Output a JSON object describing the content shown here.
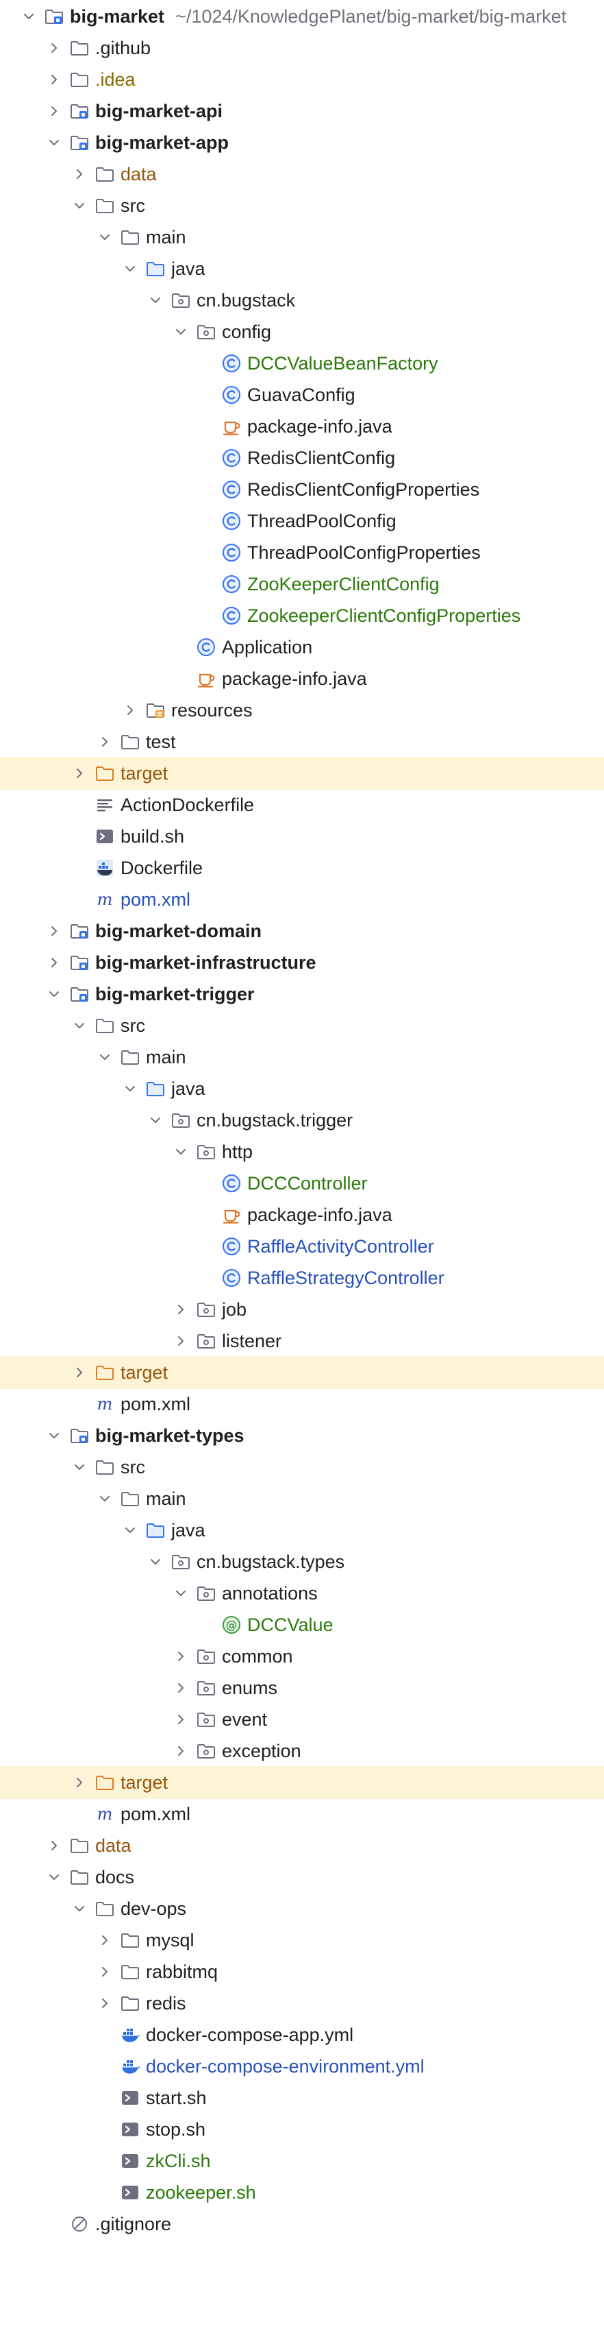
{
  "colors": {
    "module_green": "#2b7a0b",
    "modified_blue": "#2750b8",
    "excluded_orange": "#94560f",
    "highlight_row": "#fdf4d6",
    "folder_gray": "#6c707e",
    "source_blue": "#3574f0",
    "class_blue": "#3574f0",
    "docker_blue": "#2f6fe0"
  },
  "project": {
    "name": "big-market",
    "path": "~/1024/KnowledgePlanet/big-market/big-market"
  },
  "rows": [
    {
      "label": "big-market",
      "depth": 0,
      "chevron": "down",
      "icon": "module-folder-icon",
      "style": "bold",
      "path_key": "project.path"
    },
    {
      "label": ".github",
      "depth": 1,
      "chevron": "right",
      "icon": "folder-icon",
      "style": "normal"
    },
    {
      "label": ".idea",
      "depth": 1,
      "chevron": "right",
      "icon": "folder-icon",
      "style": "ignored"
    },
    {
      "label": "big-market-api",
      "depth": 1,
      "chevron": "right",
      "icon": "module-folder-icon",
      "style": "bold"
    },
    {
      "label": "big-market-app",
      "depth": 1,
      "chevron": "down",
      "icon": "module-folder-icon",
      "style": "bold"
    },
    {
      "label": "data",
      "depth": 2,
      "chevron": "right",
      "icon": "folder-icon",
      "style": "excluded"
    },
    {
      "label": "src",
      "depth": 2,
      "chevron": "down",
      "icon": "folder-icon",
      "style": "normal"
    },
    {
      "label": "main",
      "depth": 3,
      "chevron": "down",
      "icon": "folder-icon",
      "style": "normal"
    },
    {
      "label": "java",
      "depth": 4,
      "chevron": "down",
      "icon": "source-folder-icon",
      "style": "normal"
    },
    {
      "label": "cn.bugstack",
      "depth": 5,
      "chevron": "down",
      "icon": "package-icon",
      "style": "normal"
    },
    {
      "label": "config",
      "depth": 6,
      "chevron": "down",
      "icon": "package-icon",
      "style": "normal"
    },
    {
      "label": "DCCValueBeanFactory",
      "depth": 7,
      "chevron": "none",
      "icon": "class-icon",
      "style": "green"
    },
    {
      "label": "GuavaConfig",
      "depth": 7,
      "chevron": "none",
      "icon": "class-icon",
      "style": "normal"
    },
    {
      "label": "package-info.java",
      "depth": 7,
      "chevron": "none",
      "icon": "java-file-icon",
      "style": "normal"
    },
    {
      "label": "RedisClientConfig",
      "depth": 7,
      "chevron": "none",
      "icon": "class-icon",
      "style": "normal"
    },
    {
      "label": "RedisClientConfigProperties",
      "depth": 7,
      "chevron": "none",
      "icon": "class-icon",
      "style": "normal"
    },
    {
      "label": "ThreadPoolConfig",
      "depth": 7,
      "chevron": "none",
      "icon": "class-icon",
      "style": "normal"
    },
    {
      "label": "ThreadPoolConfigProperties",
      "depth": 7,
      "chevron": "none",
      "icon": "class-icon",
      "style": "normal"
    },
    {
      "label": "ZooKeeperClientConfig",
      "depth": 7,
      "chevron": "none",
      "icon": "class-icon",
      "style": "green"
    },
    {
      "label": "ZookeeperClientConfigProperties",
      "depth": 7,
      "chevron": "none",
      "icon": "class-icon",
      "style": "green"
    },
    {
      "label": "Application",
      "depth": 6,
      "chevron": "none",
      "icon": "class-icon",
      "style": "normal"
    },
    {
      "label": "package-info.java",
      "depth": 6,
      "chevron": "none",
      "icon": "java-file-icon",
      "style": "normal"
    },
    {
      "label": "resources",
      "depth": 4,
      "chevron": "right",
      "icon": "resources-folder-icon",
      "style": "normal"
    },
    {
      "label": "test",
      "depth": 3,
      "chevron": "right",
      "icon": "folder-icon",
      "style": "normal"
    },
    {
      "label": "target",
      "depth": 2,
      "chevron": "right",
      "icon": "excluded-folder-icon",
      "style": "excluded",
      "highlight": true
    },
    {
      "label": "ActionDockerfile",
      "depth": 2,
      "chevron": "none",
      "icon": "text-file-icon",
      "style": "normal"
    },
    {
      "label": "build.sh",
      "depth": 2,
      "chevron": "none",
      "icon": "shell-script-icon",
      "style": "normal"
    },
    {
      "label": "Dockerfile",
      "depth": 2,
      "chevron": "none",
      "icon": "dockerfile-icon",
      "style": "normal"
    },
    {
      "label": "pom.xml",
      "depth": 2,
      "chevron": "none",
      "icon": "maven-icon",
      "style": "blue"
    },
    {
      "label": "big-market-domain",
      "depth": 1,
      "chevron": "right",
      "icon": "module-folder-icon",
      "style": "bold"
    },
    {
      "label": "big-market-infrastructure",
      "depth": 1,
      "chevron": "right",
      "icon": "module-folder-icon",
      "style": "bold"
    },
    {
      "label": "big-market-trigger",
      "depth": 1,
      "chevron": "down",
      "icon": "module-folder-icon",
      "style": "bold"
    },
    {
      "label": "src",
      "depth": 2,
      "chevron": "down",
      "icon": "folder-icon",
      "style": "normal"
    },
    {
      "label": "main",
      "depth": 3,
      "chevron": "down",
      "icon": "folder-icon",
      "style": "normal"
    },
    {
      "label": "java",
      "depth": 4,
      "chevron": "down",
      "icon": "source-folder-icon",
      "style": "normal"
    },
    {
      "label": "cn.bugstack.trigger",
      "depth": 5,
      "chevron": "down",
      "icon": "package-icon",
      "style": "normal"
    },
    {
      "label": "http",
      "depth": 6,
      "chevron": "down",
      "icon": "package-icon",
      "style": "normal"
    },
    {
      "label": "DCCController",
      "depth": 7,
      "chevron": "none",
      "icon": "class-icon",
      "style": "green"
    },
    {
      "label": "package-info.java",
      "depth": 7,
      "chevron": "none",
      "icon": "java-file-icon",
      "style": "normal"
    },
    {
      "label": "RaffleActivityController",
      "depth": 7,
      "chevron": "none",
      "icon": "class-icon",
      "style": "blue"
    },
    {
      "label": "RaffleStrategyController",
      "depth": 7,
      "chevron": "none",
      "icon": "class-icon",
      "style": "blue"
    },
    {
      "label": "job",
      "depth": 6,
      "chevron": "right",
      "icon": "package-icon",
      "style": "normal"
    },
    {
      "label": "listener",
      "depth": 6,
      "chevron": "right",
      "icon": "package-icon",
      "style": "normal"
    },
    {
      "label": "target",
      "depth": 2,
      "chevron": "right",
      "icon": "excluded-folder-icon",
      "style": "excluded",
      "highlight": true
    },
    {
      "label": "pom.xml",
      "depth": 2,
      "chevron": "none",
      "icon": "maven-icon",
      "style": "normal"
    },
    {
      "label": "big-market-types",
      "depth": 1,
      "chevron": "down",
      "icon": "module-folder-icon",
      "style": "bold"
    },
    {
      "label": "src",
      "depth": 2,
      "chevron": "down",
      "icon": "folder-icon",
      "style": "normal"
    },
    {
      "label": "main",
      "depth": 3,
      "chevron": "down",
      "icon": "folder-icon",
      "style": "normal"
    },
    {
      "label": "java",
      "depth": 4,
      "chevron": "down",
      "icon": "source-folder-icon",
      "style": "normal"
    },
    {
      "label": "cn.bugstack.types",
      "depth": 5,
      "chevron": "down",
      "icon": "package-icon",
      "style": "normal"
    },
    {
      "label": "annotations",
      "depth": 6,
      "chevron": "down",
      "icon": "package-icon",
      "style": "normal"
    },
    {
      "label": "DCCValue",
      "depth": 7,
      "chevron": "none",
      "icon": "annotation-icon",
      "style": "green"
    },
    {
      "label": "common",
      "depth": 6,
      "chevron": "right",
      "icon": "package-icon",
      "style": "normal"
    },
    {
      "label": "enums",
      "depth": 6,
      "chevron": "right",
      "icon": "package-icon",
      "style": "normal"
    },
    {
      "label": "event",
      "depth": 6,
      "chevron": "right",
      "icon": "package-icon",
      "style": "normal"
    },
    {
      "label": "exception",
      "depth": 6,
      "chevron": "right",
      "icon": "package-icon",
      "style": "normal"
    },
    {
      "label": "target",
      "depth": 2,
      "chevron": "right",
      "icon": "excluded-folder-icon",
      "style": "excluded",
      "highlight": true
    },
    {
      "label": "pom.xml",
      "depth": 2,
      "chevron": "none",
      "icon": "maven-icon",
      "style": "normal"
    },
    {
      "label": "data",
      "depth": 1,
      "chevron": "right",
      "icon": "folder-icon",
      "style": "excluded"
    },
    {
      "label": "docs",
      "depth": 1,
      "chevron": "down",
      "icon": "folder-icon",
      "style": "normal"
    },
    {
      "label": "dev-ops",
      "depth": 2,
      "chevron": "down",
      "icon": "folder-icon",
      "style": "normal"
    },
    {
      "label": "mysql",
      "depth": 3,
      "chevron": "right",
      "icon": "folder-icon",
      "style": "normal"
    },
    {
      "label": "rabbitmq",
      "depth": 3,
      "chevron": "right",
      "icon": "folder-icon",
      "style": "normal"
    },
    {
      "label": "redis",
      "depth": 3,
      "chevron": "right",
      "icon": "folder-icon",
      "style": "normal"
    },
    {
      "label": "docker-compose-app.yml",
      "depth": 3,
      "chevron": "none",
      "icon": "docker-icon",
      "style": "normal"
    },
    {
      "label": "docker-compose-environment.yml",
      "depth": 3,
      "chevron": "none",
      "icon": "docker-icon",
      "style": "blue"
    },
    {
      "label": "start.sh",
      "depth": 3,
      "chevron": "none",
      "icon": "shell-script-icon",
      "style": "normal"
    },
    {
      "label": "stop.sh",
      "depth": 3,
      "chevron": "none",
      "icon": "shell-script-icon",
      "style": "normal"
    },
    {
      "label": "zkCli.sh",
      "depth": 3,
      "chevron": "none",
      "icon": "shell-script-icon",
      "style": "green"
    },
    {
      "label": "zookeeper.sh",
      "depth": 3,
      "chevron": "none",
      "icon": "shell-script-icon",
      "style": "green"
    },
    {
      "label": ".gitignore",
      "depth": 1,
      "chevron": "none",
      "icon": "ignore-file-icon",
      "style": "normal"
    }
  ]
}
